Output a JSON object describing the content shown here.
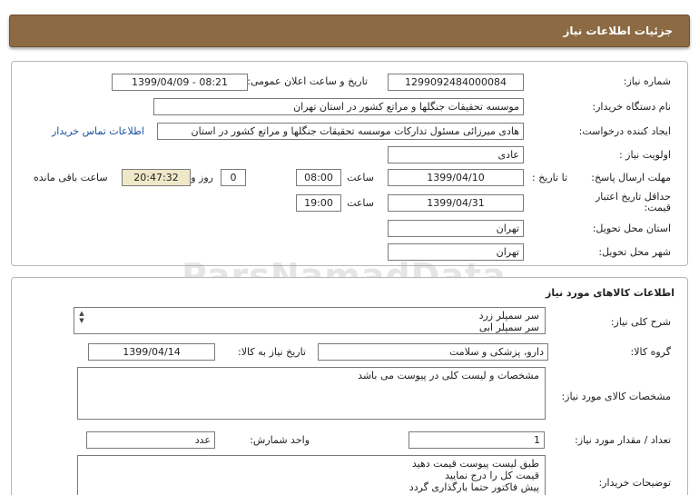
{
  "header": {
    "title": "جزئیات اطلاعات نیاز"
  },
  "need_info": {
    "need_number_label": "شماره نیاز:",
    "need_number": "1299092484000084",
    "announce_label": "تاریخ و ساعت اعلان عمومی:",
    "announce_value": "1399/04/09 - 08:21",
    "buyer_label": "نام دستگاه خریدار:",
    "buyer_value": "موسسه تحقیقات جنگلها و مراتع کشور در استان تهران",
    "requester_label": "ایجاد کننده درخواست:",
    "requester_value": "هادی میرزائی مسئول تدارکات موسسه تحقیقات جنگلها و مراتع کشور در استان",
    "contact_link": "اطلاعات تماس خریدار",
    "priority_label": "اولویت نیاز :",
    "priority_value": "عادی",
    "deadline_label": "مهلت ارسال پاسخ:",
    "to_date_label": "تا تاریخ :",
    "deadline_date": "1399/04/10",
    "time_label": "ساعت",
    "deadline_time": "08:00",
    "days_value": "0",
    "days_label": "روز و",
    "remaining_time": "20:47:32",
    "remaining_label": "ساعت باقی مانده",
    "validity_label": "حداقل تاریخ اعتبار قیمت:",
    "validity_to_label": "تا تاریخ :",
    "validity_date": "1399/04/31",
    "validity_time_label": "ساعت",
    "validity_time": "19:00",
    "province_label": "استان محل تحویل:",
    "province_value": "تهران",
    "city_label": "شهر محل تحویل:",
    "city_value": "تهران"
  },
  "goods": {
    "section_title": "اطلاعات کالاهای مورد نیاز",
    "desc_label": "شرح کلی نیاز:",
    "desc_line1": "سر سمپلر زرد",
    "desc_line2": "سر سمپلر ابی",
    "group_label": "گروه کالا:",
    "group_value": "دارو، پزشکی و سلامت",
    "need_date_label": "تاریخ نیاز به کالا:",
    "need_date": "1399/04/14",
    "spec_label": "مشخصات کالای مورد نیاز:",
    "spec_value": "مشخصات و لیست کلی در پیوست می باشد",
    "qty_label": "تعداد / مقدار مورد نیاز:",
    "qty_value": "1",
    "unit_label": "واحد شمارش:",
    "unit_value": "عدد",
    "buyer_notes_label": "توضیحات خریدار:",
    "notes_line1": "طبق لیست پیوست قیمت دهید",
    "notes_line2": "قیمت کل را درج نمایید",
    "notes_line3": "پیش فاکتور حتما بارگذاری گردد"
  },
  "watermark": {
    "line1": "ParsNamadData",
    "line2": "مرکز فراوری اطلاعات پارس نماد داده ها",
    "line3": "۰۲۱-۸۸۳۴۹۶۷۰-۵"
  }
}
